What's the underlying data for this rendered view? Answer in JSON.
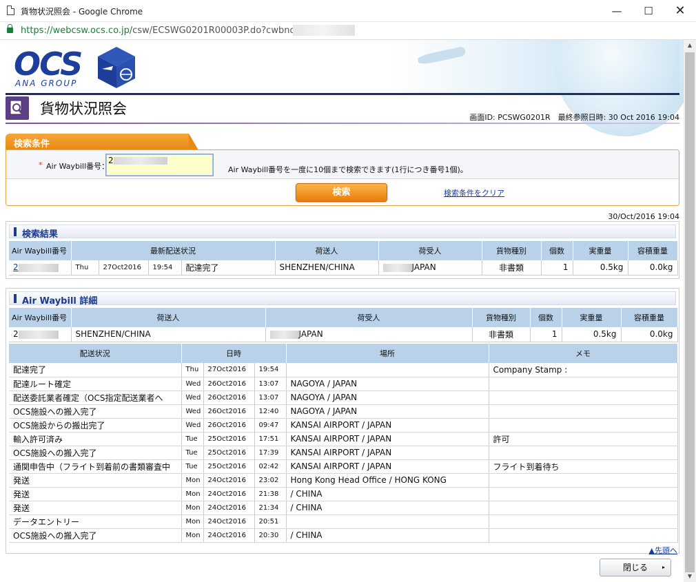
{
  "window": {
    "title": "貨物状況照会 - Google Chrome",
    "url_secure": "https://webcsw.ocs.co.jp",
    "url_rest": "/csw/ECSWG0201R00003P.do?cwbno=2",
    "minimize": "—",
    "maximize": "☐",
    "close": "✕"
  },
  "brand": {
    "logo": "OCS",
    "subtitle": "ANA GROUP"
  },
  "page": {
    "title": "貨物状況照会",
    "meta": "画面ID: PCSWG0201R　最終参照日時: 30 Oct 2016 19:04"
  },
  "search": {
    "tab_label": "検索条件",
    "required_mark": "*",
    "awb_label": "Air Waybill番号：",
    "awb_value": "2",
    "hint": "Air Waybill番号を一度に10個まで検索できます(1行につき番号1個)。",
    "search_button": "検索",
    "clear_link": "検索条件をクリア"
  },
  "date_stamp": "30/Oct/2016 19:04",
  "results": {
    "title": "検索結果",
    "headers": [
      "Air Waybill番号",
      "最新配送状況",
      "荷送人",
      "荷受人",
      "貨物種別",
      "個数",
      "実重量",
      "容積重量"
    ],
    "row": {
      "awb": "2",
      "day": "Thu",
      "date": "27Oct2016",
      "time": "19:54",
      "status": "配達完了",
      "shipper": "SHENZHEN/CHINA",
      "consignee": "JAPAN",
      "type": "非書類",
      "pieces": "1",
      "weight": "0.5kg",
      "volume": "0.0kg"
    }
  },
  "detail": {
    "title": "Air Waybill 詳細",
    "headers": [
      "Air Waybill番号",
      "荷送人",
      "荷受人",
      "貨物種別",
      "個数",
      "実重量",
      "容積重量"
    ],
    "row": {
      "awb": "2",
      "shipper": "SHENZHEN/CHINA",
      "consignee": "JAPAN",
      "type": "非書類",
      "pieces": "1",
      "weight": "0.5kg",
      "volume": "0.0kg"
    },
    "history_headers": [
      "配送状況",
      "日時",
      "場所",
      "メモ"
    ],
    "history": [
      {
        "status": "配達完了",
        "day": "Thu",
        "date": "27Oct2016",
        "time": "19:54",
        "place": "",
        "memo": "Company Stamp :"
      },
      {
        "status": "配達ルート確定",
        "day": "Wed",
        "date": "26Oct2016",
        "time": "13:07",
        "place": "NAGOYA / JAPAN",
        "memo": ""
      },
      {
        "status": "配送委託業者確定（OCS指定配送業者へ",
        "day": "Wed",
        "date": "26Oct2016",
        "time": "13:07",
        "place": "NAGOYA / JAPAN",
        "memo": ""
      },
      {
        "status": "OCS施設への搬入完了",
        "day": "Wed",
        "date": "26Oct2016",
        "time": "12:40",
        "place": "NAGOYA / JAPAN",
        "memo": ""
      },
      {
        "status": "OCS施設からの搬出完了",
        "day": "Wed",
        "date": "26Oct2016",
        "time": "09:47",
        "place": "KANSAI AIRPORT / JAPAN",
        "memo": ""
      },
      {
        "status": "輸入許可済み",
        "day": "Tue",
        "date": "25Oct2016",
        "time": "17:51",
        "place": "KANSAI AIRPORT / JAPAN",
        "memo": "許可"
      },
      {
        "status": "OCS施設への搬入完了",
        "day": "Tue",
        "date": "25Oct2016",
        "time": "17:39",
        "place": "KANSAI AIRPORT / JAPAN",
        "memo": ""
      },
      {
        "status": "通関申告中（フライト到着前の書類審査中",
        "day": "Tue",
        "date": "25Oct2016",
        "time": "02:42",
        "place": "KANSAI AIRPORT / JAPAN",
        "memo": "フライト到着待ち"
      },
      {
        "status": "発送",
        "day": "Mon",
        "date": "24Oct2016",
        "time": "23:02",
        "place": "Hong Kong Head Office / HONG KONG",
        "memo": ""
      },
      {
        "status": "発送",
        "day": "Mon",
        "date": "24Oct2016",
        "time": "21:38",
        "place": " / CHINA",
        "memo": ""
      },
      {
        "status": "発送",
        "day": "Mon",
        "date": "24Oct2016",
        "time": "21:34",
        "place": " / CHINA",
        "memo": ""
      },
      {
        "status": "データエントリー",
        "day": "Mon",
        "date": "24Oct2016",
        "time": "20:51",
        "place": "",
        "memo": ""
      },
      {
        "status": "OCS施設への搬入完了",
        "day": "Mon",
        "date": "24Oct2016",
        "time": "20:30",
        "place": " / CHINA",
        "memo": ""
      }
    ],
    "to_top": "▲先頭へ"
  },
  "footer": {
    "close_button": "閉じる",
    "close_arrow": "▸"
  },
  "colors": {
    "brand": "#1d3e9b",
    "accent": "#e97d0a",
    "header_blue": "#b9d2ea",
    "title_purple": "#5d3f86"
  }
}
